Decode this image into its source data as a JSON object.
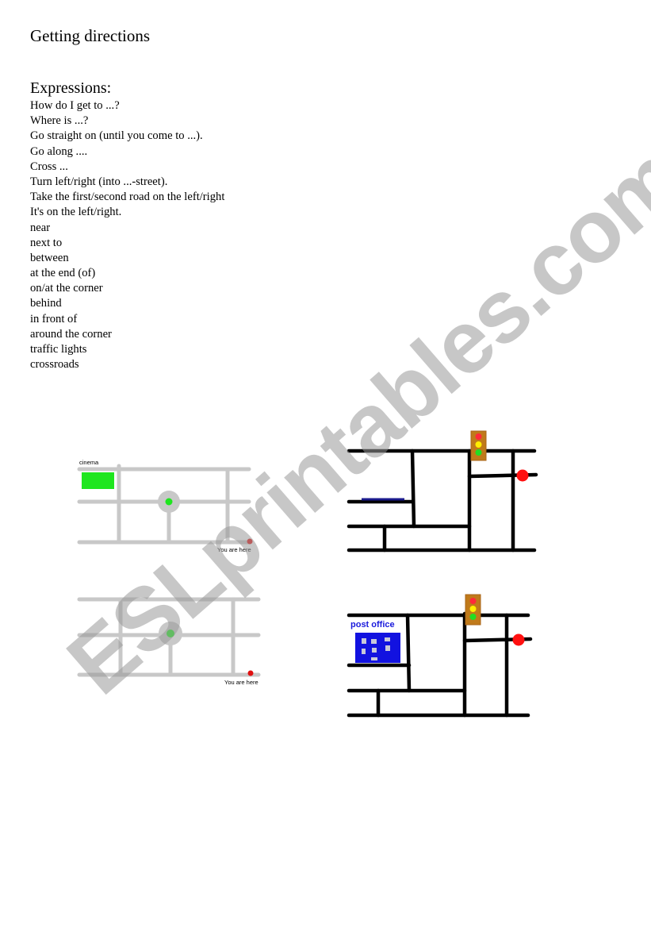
{
  "document": {
    "title": "Getting directions",
    "section_heading": "Expressions:",
    "expressions": [
      "How do I get to ...?",
      "Where is ...?",
      "Go straight on (until you come to ...).",
      "Go along ....",
      "Cross ...",
      "Turn left/right (into ...-street).",
      "Take the first/second road on the left/right",
      "It's on the left/right.",
      "near",
      "next to",
      "between",
      "at the end (of)",
      "on/at the corner",
      "behind",
      "in front of",
      "around the corner",
      "traffic lights",
      "crossroads"
    ]
  },
  "maps": [
    {
      "id": "map-1",
      "style": "grey-roads",
      "labels": {
        "landmark": "cinema",
        "you_are_here": "You are here"
      },
      "colors": {
        "road": "#c8c8c8",
        "landmark": "#1fe61f",
        "roundabout_center": "#1fe61f",
        "start_marker": "#e01010"
      }
    },
    {
      "id": "map-2",
      "style": "black-roads",
      "labels": {},
      "colors": {
        "road": "#000000",
        "traffic_light_box": "#c07a1a",
        "start_marker": "#ff1010",
        "highlight": "#1a1a8c"
      }
    },
    {
      "id": "map-3",
      "style": "grey-roads",
      "labels": {
        "you_are_here": "You are here"
      },
      "colors": {
        "road": "#c8c8c8",
        "roundabout_center": "#1fe61f",
        "start_marker": "#e01010"
      }
    },
    {
      "id": "map-4",
      "style": "black-roads",
      "labels": {
        "landmark": "post office"
      },
      "colors": {
        "road": "#000000",
        "building": "#1212e0",
        "window": "#c8c8d8",
        "traffic_light_box": "#c07a1a",
        "start_marker": "#ff1010"
      }
    }
  ],
  "traffic_light_colors": {
    "red": "#ff2a3a",
    "yellow": "#ffee00",
    "green": "#22dd22"
  },
  "watermark": {
    "text": "ESLprintables.com"
  }
}
